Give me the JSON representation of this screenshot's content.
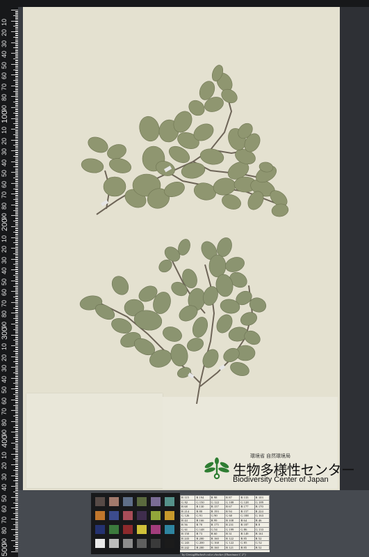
{
  "ruler": {
    "labels": [
      "10",
      "20",
      "30",
      "40",
      "50",
      "60",
      "70",
      "80",
      "90",
      "100",
      "10",
      "20",
      "30",
      "40",
      "50",
      "60",
      "70",
      "80",
      "90",
      "200",
      "10",
      "20",
      "30",
      "40",
      "50",
      "60",
      "70",
      "80",
      "90",
      "300",
      "10",
      "20",
      "30",
      "40",
      "50",
      "60",
      "70",
      "80",
      "90",
      "400",
      "10",
      "20",
      "30",
      "40",
      "50",
      "60",
      "70",
      "80",
      "90",
      "500"
    ]
  },
  "label": {
    "agency": "環境省 自然環境局",
    "title": "生物多様性センター",
    "subtitle": "Biodiversity Center of Japan"
  },
  "color_card": {
    "swatches": [
      "#574a46",
      "#a27a6c",
      "#5f6f88",
      "#5a6a3e",
      "#7a6c95",
      "#55918a",
      "#c0762c",
      "#3c4c8e",
      "#a84d58",
      "#3f2d4d",
      "#92a63a",
      "#c79a2c",
      "#243270",
      "#3c7a3d",
      "#8d2a2c",
      "#cfc13a",
      "#a33d7c",
      "#2e84a0",
      "#e9e9e9",
      "#bdbdbd",
      "#8d8d8d",
      "#5f5f5f",
      "#3a3a3a",
      "#1b1b1b"
    ]
  },
  "color_table": {
    "rows": [
      [
        "R 115",
        "R 194",
        "R 98",
        "R 87",
        "R 133",
        "R 103"
      ],
      [
        "G 82",
        "G 150",
        "G 122",
        "G 108",
        "G 128",
        "G 189"
      ],
      [
        "B 68",
        "B 130",
        "B 157",
        "B 67",
        "B 177",
        "B 170"
      ],
      [
        "R 214",
        "R 80",
        "R 193",
        "R 94",
        "R 157",
        "R 224"
      ],
      [
        "G 126",
        "G 91",
        "G 90",
        "G 60",
        "G 188",
        "G 163"
      ],
      [
        "B 44",
        "B 166",
        "B 99",
        "B 108",
        "B 64",
        "B 46"
      ],
      [
        "R 56",
        "R 70",
        "R 175",
        "R 231",
        "R 187",
        "R 8"
      ],
      [
        "G 61",
        "G 148",
        "G 54",
        "G 199",
        "G 86",
        "G 133"
      ],
      [
        "B 150",
        "B 73",
        "B 60",
        "B 31",
        "B 149",
        "B 161"
      ],
      [
        "R 243",
        "R 200",
        "R 160",
        "R 122",
        "R 85",
        "R 52"
      ],
      [
        "G 243",
        "G 200",
        "G 160",
        "G 122",
        "G 85",
        "G 52"
      ],
      [
        "B 242",
        "B 200",
        "B 160",
        "B 121",
        "B 85",
        "B 52"
      ]
    ]
  },
  "caption": "by GretagMacbeth color checker (Illuminant C 2°)"
}
